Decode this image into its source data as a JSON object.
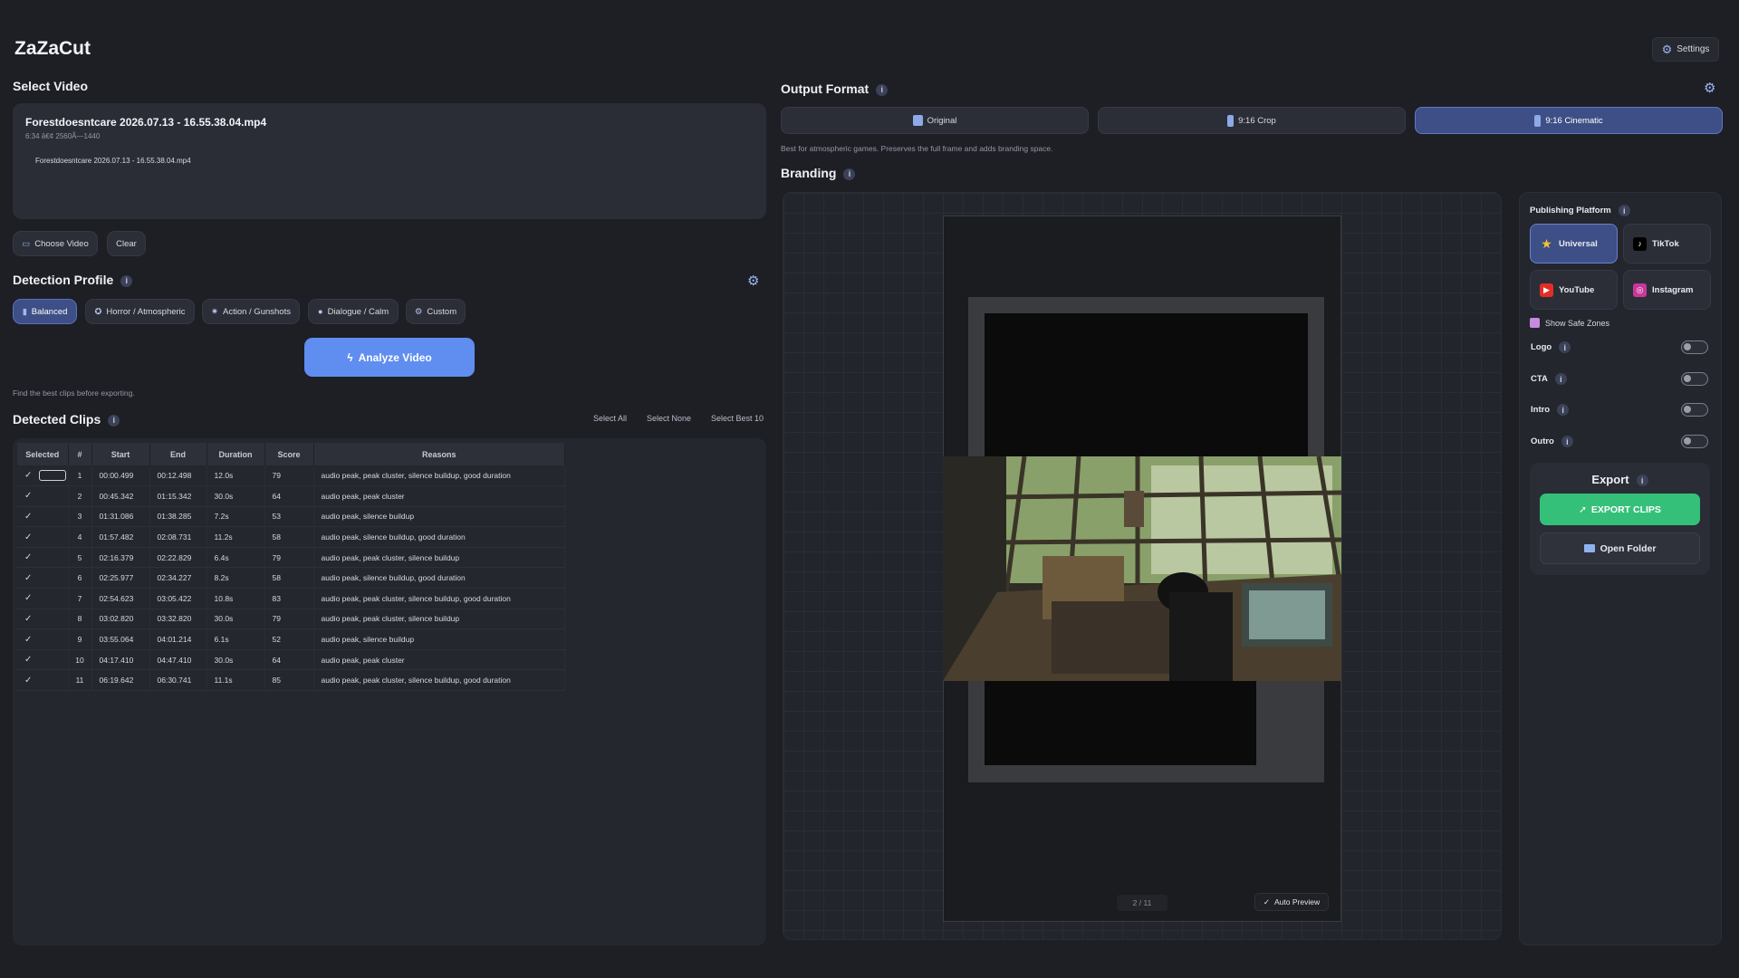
{
  "app": {
    "title": "ZaZaCut",
    "settings_label": "Settings"
  },
  "select_video": {
    "title": "Select Video",
    "file_name": "Forestdoesntcare 2026.07.13 - 16.55.38.04.mp4",
    "meta": "6:34 â€¢ 2560Ã—1440",
    "file_entry": "Forestdoesntcare 2026.07.13 - 16.55.38.04.mp4",
    "choose_label": "Choose Video",
    "clear_label": "Clear"
  },
  "detection_profile": {
    "title": "Detection Profile",
    "profiles": [
      "Balanced",
      "Horror / Atmospheric",
      "Action / Gunshots",
      "Dialogue / Calm",
      "Custom"
    ],
    "active": "Balanced",
    "analyze_label": "Analyze Video",
    "hint": "Find the best clips before exporting."
  },
  "detected_clips": {
    "title": "Detected Clips",
    "select_all": "Select All",
    "select_none": "Select None",
    "select_best": "Select Best 10",
    "columns": [
      "Selected",
      "#",
      "Start",
      "End",
      "Duration",
      "Score",
      "Reasons"
    ],
    "rows": [
      {
        "n": "1",
        "start": "00:00.499",
        "end": "00:12.498",
        "dur": "12.0s",
        "score": "79",
        "reasons": "audio peak, peak cluster, silence buildup, good duration"
      },
      {
        "n": "2",
        "start": "00:45.342",
        "end": "01:15.342",
        "dur": "30.0s",
        "score": "64",
        "reasons": "audio peak, peak cluster"
      },
      {
        "n": "3",
        "start": "01:31.086",
        "end": "01:38.285",
        "dur": "7.2s",
        "score": "53",
        "reasons": "audio peak, silence buildup"
      },
      {
        "n": "4",
        "start": "01:57.482",
        "end": "02:08.731",
        "dur": "11.2s",
        "score": "58",
        "reasons": "audio peak, silence buildup, good duration"
      },
      {
        "n": "5",
        "start": "02:16.379",
        "end": "02:22.829",
        "dur": "6.4s",
        "score": "79",
        "reasons": "audio peak, peak cluster, silence buildup"
      },
      {
        "n": "6",
        "start": "02:25.977",
        "end": "02:34.227",
        "dur": "8.2s",
        "score": "58",
        "reasons": "audio peak, silence buildup, good duration"
      },
      {
        "n": "7",
        "start": "02:54.623",
        "end": "03:05.422",
        "dur": "10.8s",
        "score": "83",
        "reasons": "audio peak, peak cluster, silence buildup, good duration"
      },
      {
        "n": "8",
        "start": "03:02.820",
        "end": "03:32.820",
        "dur": "30.0s",
        "score": "79",
        "reasons": "audio peak, peak cluster, silence buildup"
      },
      {
        "n": "9",
        "start": "03:55.064",
        "end": "04:01.214",
        "dur": "6.1s",
        "score": "52",
        "reasons": "audio peak, silence buildup"
      },
      {
        "n": "10",
        "start": "04:17.410",
        "end": "04:47.410",
        "dur": "30.0s",
        "score": "64",
        "reasons": "audio peak, peak cluster"
      },
      {
        "n": "11",
        "start": "06:19.642",
        "end": "06:30.741",
        "dur": "11.1s",
        "score": "85",
        "reasons": "audio peak, peak cluster, silence buildup, good duration"
      }
    ]
  },
  "output_format": {
    "title": "Output Format",
    "options": [
      "Original",
      "9:16 Crop",
      "9:16 Cinematic"
    ],
    "active": "9:16 Cinematic",
    "description": "Best for atmospheric games. Preserves the full frame and adds branding space."
  },
  "branding": {
    "title": "Branding",
    "counter": "2 / 11",
    "auto_preview": "Auto Preview"
  },
  "publishing": {
    "title": "Publishing Platform",
    "platforms": [
      "Universal",
      "TikTok",
      "YouTube",
      "Instagram"
    ],
    "active": "Universal",
    "safe_zones": "Show Safe Zones",
    "toggles": [
      "Logo",
      "CTA",
      "Intro",
      "Outro"
    ]
  },
  "export": {
    "title": "Export",
    "export_label": "EXPORT CLIPS",
    "folder_label": "Open Folder"
  },
  "colors": {
    "accent": "#5f8ef0",
    "active_chip": "#3d4f86",
    "export_green": "#35c07a",
    "background": "#1d1f25"
  }
}
